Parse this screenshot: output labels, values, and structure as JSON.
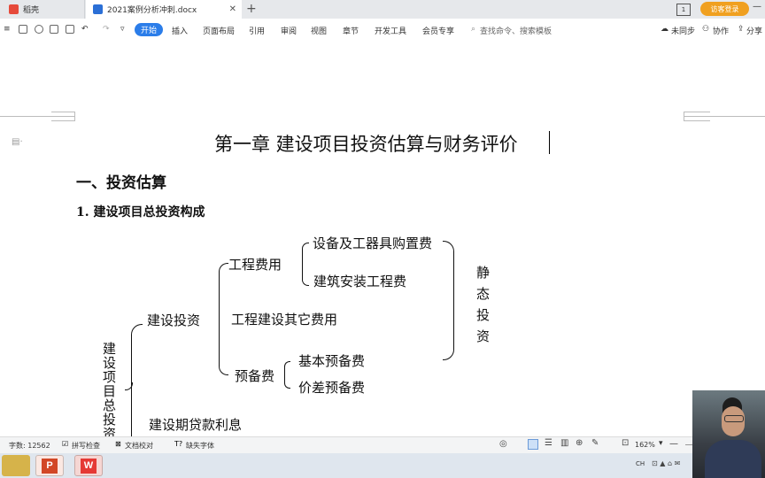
{
  "tabs": [
    {
      "label": "稻壳",
      "active": false
    },
    {
      "label": "2021案例分析冲刺.docx",
      "active": true
    }
  ],
  "topbar": {
    "page_badge": "1",
    "login": "访客登录"
  },
  "ribbon": {
    "menus": [
      "开始",
      "插入",
      "页面布局",
      "引用",
      "审阅",
      "视图",
      "章节",
      "开发工具",
      "会员专享"
    ],
    "search_placeholder": "查找命令、搜索模板",
    "right": [
      "未同步",
      "协作",
      "分享"
    ]
  },
  "document": {
    "title": "第一章  建设项目投资估算与财务评价",
    "heading1": "一、投资估算",
    "heading2": "1. 建设项目总投资构成",
    "diagram": {
      "root_chars": [
        "建",
        "设",
        "项",
        "目",
        "总",
        "投",
        "资"
      ],
      "n_invest": "建设投资",
      "n_eng_cost": "工程费用",
      "n_equip": "设备及工器具购置费",
      "n_install": "建筑安装工程费",
      "n_other": "工程建设其它费用",
      "n_reserve": "预备费",
      "n_basic": "基本预备费",
      "n_price": "价差预备费",
      "n_static_chars": [
        "静",
        "态",
        "投",
        "资"
      ],
      "n_interest": "建设期贷款利息"
    }
  },
  "statusbar": {
    "word_count": "字数: 12562",
    "spell": "拼写检查",
    "proof": "文档校对",
    "missing_font": "缺失字体",
    "zoom": "162%"
  },
  "taskbar": {
    "tray_text": "CH"
  }
}
